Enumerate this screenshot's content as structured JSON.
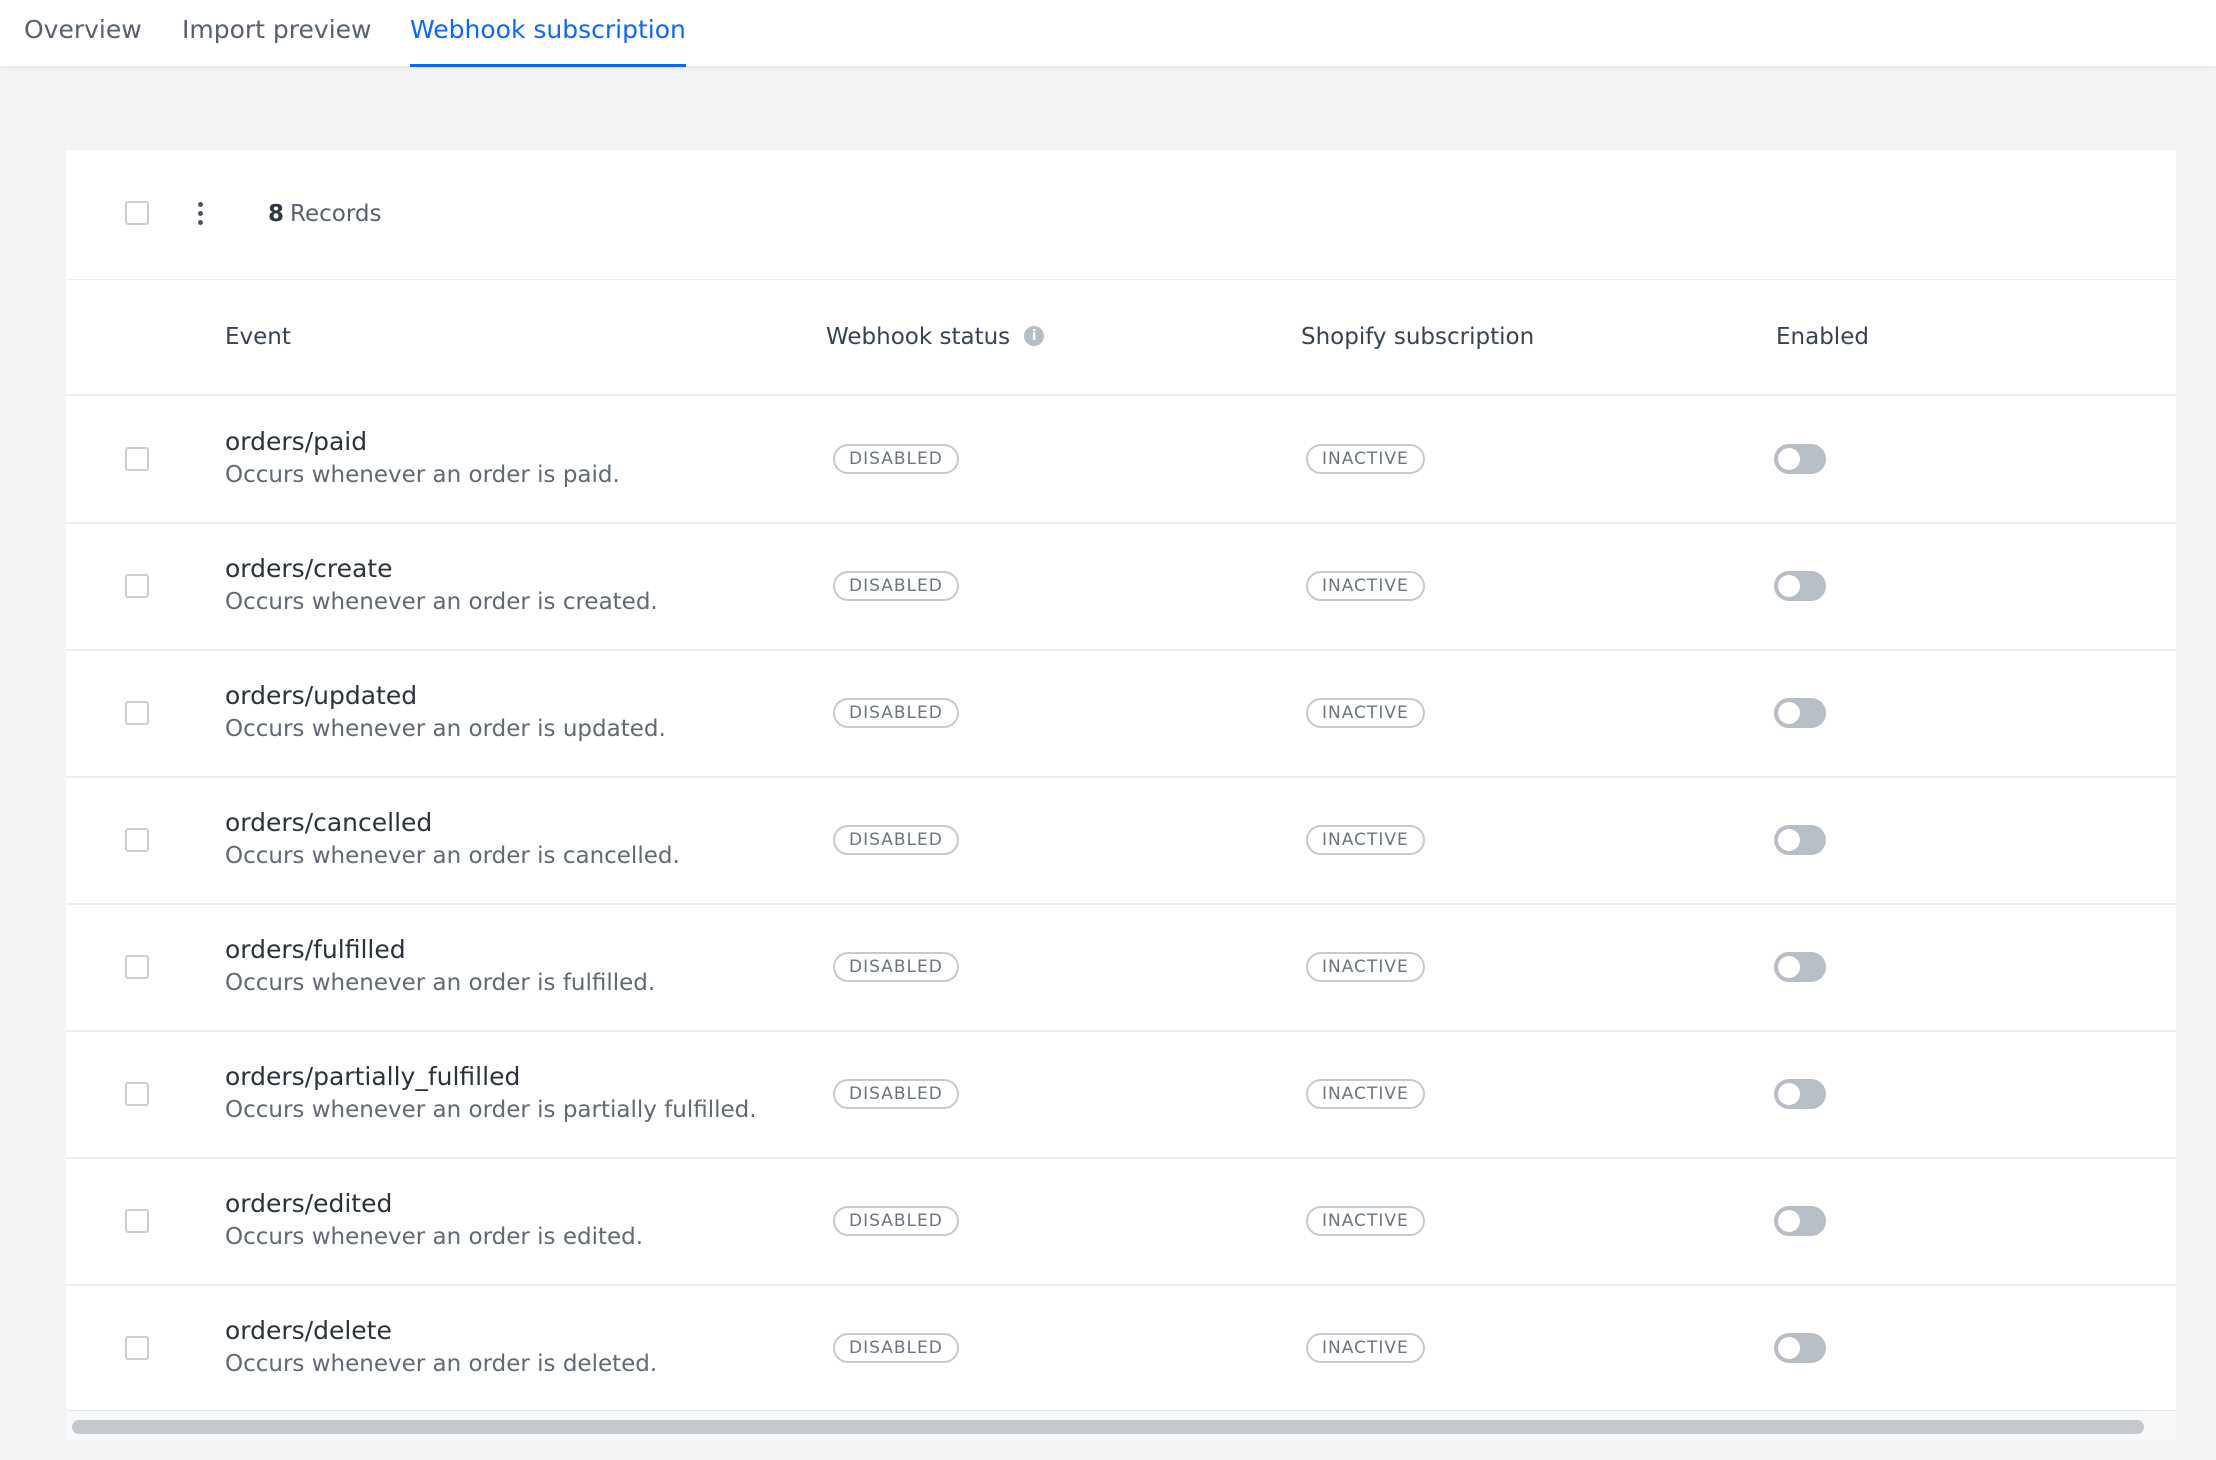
{
  "tabs": [
    {
      "label": "Overview",
      "active": false
    },
    {
      "label": "Import preview",
      "active": false
    },
    {
      "label": "Webhook subscription",
      "active": true
    }
  ],
  "toolbar": {
    "record_count": "8",
    "record_label": "Records"
  },
  "table": {
    "columns": [
      "Event",
      "Webhook status",
      "Shopify subscription",
      "Enabled"
    ],
    "rows": [
      {
        "event": "orders/paid",
        "description": "Occurs whenever an order is paid.",
        "webhook_status": "DISABLED",
        "subscription": "INACTIVE",
        "enabled": false
      },
      {
        "event": "orders/create",
        "description": "Occurs whenever an order is created.",
        "webhook_status": "DISABLED",
        "subscription": "INACTIVE",
        "enabled": false
      },
      {
        "event": "orders/updated",
        "description": "Occurs whenever an order is updated.",
        "webhook_status": "DISABLED",
        "subscription": "INACTIVE",
        "enabled": false
      },
      {
        "event": "orders/cancelled",
        "description": "Occurs whenever an order is cancelled.",
        "webhook_status": "DISABLED",
        "subscription": "INACTIVE",
        "enabled": false
      },
      {
        "event": "orders/fulfilled",
        "description": "Occurs whenever an order is fulfilled.",
        "webhook_status": "DISABLED",
        "subscription": "INACTIVE",
        "enabled": false
      },
      {
        "event": "orders/partially_fulfilled",
        "description": "Occurs whenever an order is partially fulfilled.",
        "webhook_status": "DISABLED",
        "subscription": "INACTIVE",
        "enabled": false
      },
      {
        "event": "orders/edited",
        "description": "Occurs whenever an order is edited.",
        "webhook_status": "DISABLED",
        "subscription": "INACTIVE",
        "enabled": false
      },
      {
        "event": "orders/delete",
        "description": "Occurs whenever an order is deleted.",
        "webhook_status": "DISABLED",
        "subscription": "INACTIVE",
        "enabled": false
      }
    ]
  },
  "icons": {
    "header_info": "info-icon",
    "toolbar_menu": "kebab-menu-icon"
  },
  "colors": {
    "accent": "#0b68ff",
    "background": "#f3f4f6",
    "toggle_off": "#b8bec5"
  }
}
